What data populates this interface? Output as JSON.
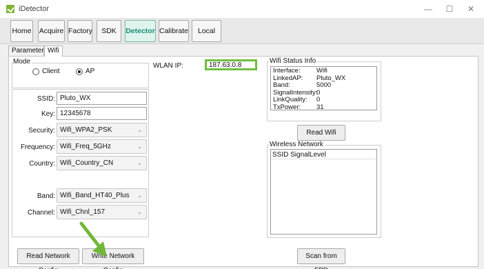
{
  "window": {
    "title": "iDetector",
    "minimize": "—",
    "maximize": "☐",
    "close": "✕"
  },
  "toolbar": {
    "buttons": [
      {
        "label": "Home"
      },
      {
        "label": "Acquire"
      },
      {
        "label": "Factory"
      },
      {
        "label": "SDK"
      },
      {
        "label": "Detector"
      },
      {
        "label": "Calibrate"
      },
      {
        "label": "Local File"
      }
    ],
    "active": "Detector",
    "accent_color": "#1a8f73"
  },
  "tabs": [
    {
      "label": "Parameters"
    },
    {
      "label": "Wifi"
    }
  ],
  "active_tab": "Wifi",
  "mode": {
    "legend": "Mode",
    "options": [
      {
        "label": "Client",
        "selected": false
      },
      {
        "label": "AP",
        "selected": true
      }
    ]
  },
  "config": {
    "ssid_label": "SSID:",
    "ssid_value": "Pluto_WX",
    "key_label": "Key:",
    "key_value": "12345678",
    "security_label": "Security:",
    "security_value": "Wifi_WPA2_PSK",
    "frequency_label": "Frequency:",
    "frequency_value": "Wifi_Freq_5GHz",
    "country_label": "Country:",
    "country_value": "Wifi_Country_CN",
    "band_label": "Band:",
    "band_value": "Wifi_Band_HT40_Plus",
    "channel_label": "Channel:",
    "channel_value": "Wifi_Chnl_157"
  },
  "wlan": {
    "label": "WLAN IP:",
    "value": "187.63.0.8",
    "highlight_color": "#6fbf3e"
  },
  "status": {
    "legend": "Wifi Status Info",
    "rows": [
      {
        "key": "Interface:",
        "value": "Wifi"
      },
      {
        "key": "LinkedAP:",
        "value": "Pluto_WX"
      },
      {
        "key": "Band:",
        "value": "5000"
      },
      {
        "key": "SignalIntensity:",
        "value": "0"
      },
      {
        "key": "LinkQuality:",
        "value": "0"
      },
      {
        "key": "TxPower:",
        "value": "31"
      }
    ],
    "read_button": "Read Wifi Status"
  },
  "wireless": {
    "legend": "Wireless Network",
    "header": "SSID SignalLevel"
  },
  "actions": {
    "read_config": "Read Network Config",
    "write_config": "Write Network Config",
    "scan": "Scan from FPD"
  },
  "annotation": {
    "arrow_color": "#72b73a"
  },
  "icons": {
    "app": "app-logo-icon",
    "dropdown": "chevron-down-icon",
    "arrow": "pointer-arrow-icon"
  }
}
